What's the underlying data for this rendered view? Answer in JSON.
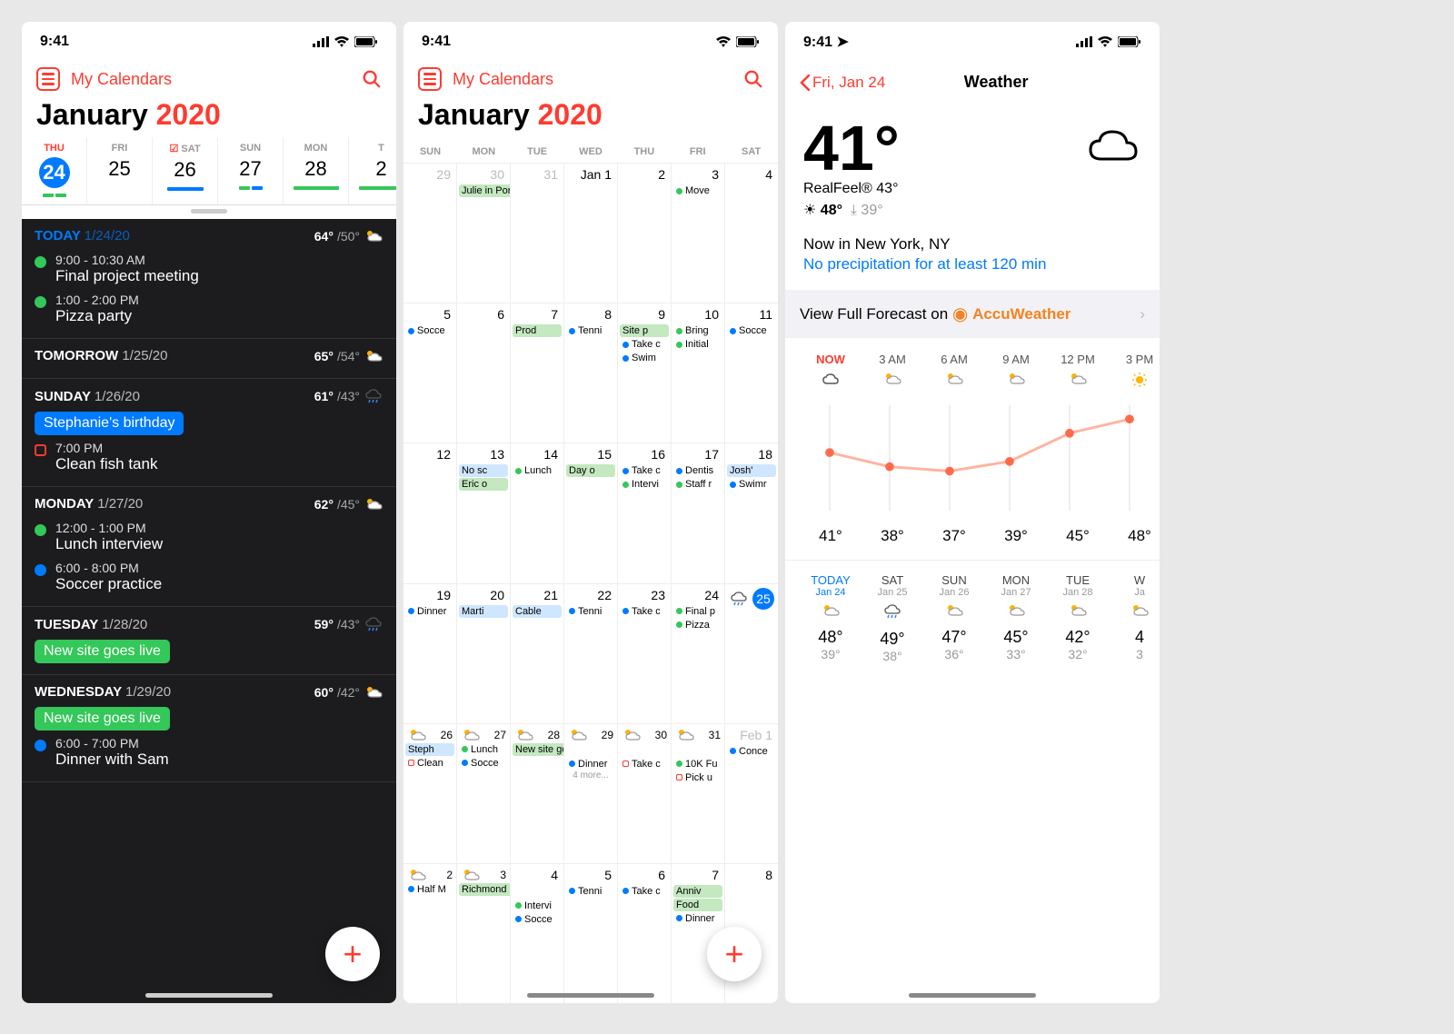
{
  "status": {
    "time": "9:41"
  },
  "header": {
    "title": "My Calendars"
  },
  "month": {
    "name": "January",
    "year": "2020"
  },
  "week": [
    {
      "dow": "THU",
      "num": "24",
      "today": true
    },
    {
      "dow": "FRI",
      "num": "25"
    },
    {
      "dow": "SAT",
      "num": "26",
      "check": true
    },
    {
      "dow": "SUN",
      "num": "27"
    },
    {
      "dow": "MON",
      "num": "28"
    },
    {
      "dow": "T",
      "num": "2"
    }
  ],
  "agenda": [
    {
      "label": "TODAY",
      "date": "1/24/20",
      "hi": "64°",
      "lo": "/50°",
      "today": true,
      "events": [
        {
          "type": "dot",
          "color": "#34c759",
          "time": "9:00 - 10:30 AM",
          "title": "Final project meeting"
        },
        {
          "type": "dot",
          "color": "#34c759",
          "time": "1:00 - 2:00 PM",
          "title": "Pizza party"
        }
      ]
    },
    {
      "label": "TOMORROW",
      "date": "1/25/20",
      "hi": "65°",
      "lo": "/54°",
      "events": []
    },
    {
      "label": "SUNDAY",
      "date": "1/26/20",
      "hi": "61°",
      "lo": "/43°",
      "events": [
        {
          "type": "chip",
          "color": "#007aff",
          "title": "Stephanie's birthday"
        },
        {
          "type": "square",
          "time": "7:00 PM",
          "title": "Clean fish tank"
        }
      ]
    },
    {
      "label": "MONDAY",
      "date": "1/27/20",
      "hi": "62°",
      "lo": "/45°",
      "events": [
        {
          "type": "dot",
          "color": "#34c759",
          "time": "12:00 - 1:00 PM",
          "title": "Lunch interview"
        },
        {
          "type": "dot",
          "color": "#007aff",
          "time": "6:00 - 8:00 PM",
          "title": "Soccer practice"
        }
      ]
    },
    {
      "label": "TUESDAY",
      "date": "1/28/20",
      "hi": "59°",
      "lo": "/43°",
      "events": [
        {
          "type": "chip",
          "color": "#34c759",
          "title": "New site goes live"
        }
      ]
    },
    {
      "label": "WEDNESDAY",
      "date": "1/29/20",
      "hi": "60°",
      "lo": "/42°",
      "events": [
        {
          "type": "chip",
          "color": "#34c759",
          "title": "New site goes live"
        },
        {
          "type": "dot",
          "color": "#007aff",
          "time": "6:00 - 7:00 PM",
          "title": "Dinner with Sam"
        }
      ]
    }
  ],
  "dows": [
    "SUN",
    "MON",
    "TUE",
    "WED",
    "THU",
    "FRI",
    "SAT"
  ],
  "grid": [
    [
      {
        "n": "29",
        "m": 1
      },
      {
        "n": "30",
        "m": 1,
        "ev": [
          {
            "block": "g",
            "t": "Julie in Portland",
            "span": 3
          }
        ]
      },
      {
        "n": "31",
        "m": 1
      },
      {
        "n": "Jan 1"
      },
      {
        "n": "2"
      },
      {
        "n": "3",
        "ev": [
          {
            "d": "#34c759",
            "t": "Move "
          }
        ]
      },
      {
        "n": "4"
      }
    ],
    [
      {
        "n": "5",
        "ev": [
          {
            "d": "#007aff",
            "t": "Socce"
          }
        ]
      },
      {
        "n": "6"
      },
      {
        "n": "7",
        "ev": [
          {
            "block": "g",
            "t": "Prod"
          }
        ]
      },
      {
        "n": "8",
        "ev": [
          {
            "d": "#007aff",
            "t": "Tenni"
          }
        ]
      },
      {
        "n": "9",
        "ev": [
          {
            "block": "g",
            "t": "Site p"
          },
          {
            "d": "#007aff",
            "t": "Take c"
          },
          {
            "d": "#007aff",
            "t": "Swim"
          }
        ]
      },
      {
        "n": "10",
        "ev": [
          {
            "d": "#34c759",
            "t": "Bring "
          },
          {
            "d": "#34c759",
            "t": "Initial "
          }
        ]
      },
      {
        "n": "11",
        "ev": [
          {
            "d": "#007aff",
            "t": "Socce"
          }
        ]
      }
    ],
    [
      {
        "n": "12"
      },
      {
        "n": "13",
        "ev": [
          {
            "block": "b",
            "t": "No sc"
          },
          {
            "block": "g",
            "t": "Eric o"
          }
        ]
      },
      {
        "n": "14",
        "ev": [
          {
            "d": "#34c759",
            "t": "Lunch"
          }
        ]
      },
      {
        "n": "15",
        "ev": [
          {
            "block": "g",
            "t": "Day o"
          }
        ]
      },
      {
        "n": "16",
        "ev": [
          {
            "d": "#007aff",
            "t": "Take c"
          },
          {
            "d": "#34c759",
            "t": "Intervi"
          }
        ]
      },
      {
        "n": "17",
        "ev": [
          {
            "d": "#007aff",
            "t": "Dentis"
          },
          {
            "d": "#34c759",
            "t": "Staff r"
          }
        ]
      },
      {
        "n": "18",
        "ev": [
          {
            "block": "b",
            "t": "Josh'"
          },
          {
            "d": "#007aff",
            "t": "Swimr"
          }
        ]
      }
    ],
    [
      {
        "n": "19",
        "ev": [
          {
            "d": "#007aff",
            "t": "Dinner"
          }
        ]
      },
      {
        "n": "20",
        "ev": [
          {
            "block": "b",
            "t": "Marti"
          }
        ]
      },
      {
        "n": "21",
        "ev": [
          {
            "block": "b",
            "t": "Cable"
          }
        ]
      },
      {
        "n": "22",
        "ev": [
          {
            "d": "#007aff",
            "t": "Tenni"
          }
        ]
      },
      {
        "n": "23",
        "ev": [
          {
            "d": "#007aff",
            "t": "Take c"
          }
        ]
      },
      {
        "n": "24",
        "ev": [
          {
            "d": "#34c759",
            "t": "Final p"
          },
          {
            "d": "#34c759",
            "t": "Pizza"
          }
        ]
      },
      {
        "n": "25",
        "today": 1,
        "wx": 1
      }
    ],
    [
      {
        "n": "26",
        "wx": 1,
        "ev": [
          {
            "block": "b",
            "t": "Steph"
          },
          {
            "sq": 1,
            "t": "Clean"
          }
        ]
      },
      {
        "n": "27",
        "wx": 1,
        "ev": [
          {
            "d": "#34c759",
            "t": "Lunch"
          },
          {
            "d": "#007aff",
            "t": "Socce"
          }
        ]
      },
      {
        "n": "28",
        "wx": 1,
        "ev": [
          {
            "block": "g",
            "t": "New site goes live",
            "span": 4
          }
        ]
      },
      {
        "n": "29",
        "wx": 1,
        "ev": [
          {
            "sp": 1
          },
          {
            "d": "#007aff",
            "t": "Dinner"
          },
          {
            "more": "4 more..."
          }
        ]
      },
      {
        "n": "30",
        "wx": 1,
        "ev": [
          {
            "sp": 1
          },
          {
            "sq": 1,
            "t": "Take c"
          }
        ]
      },
      {
        "n": "31",
        "wx": 1,
        "ev": [
          {
            "sp": 1
          },
          {
            "d": "#34c759",
            "t": "10K Fu"
          },
          {
            "sq": 1,
            "t": "Pick u"
          }
        ]
      },
      {
        "n": "Feb 1",
        "m": 1,
        "ev": [
          {
            "d": "#007aff",
            "t": "Conce"
          }
        ]
      }
    ],
    [
      {
        "n": "2",
        "wx": 1,
        "ev": [
          {
            "d": "#007aff",
            "t": "Half M"
          }
        ]
      },
      {
        "n": "3",
        "wx": 1,
        "ev": [
          {
            "block": "g",
            "t": "Richmond",
            "span": 2
          }
        ]
      },
      {
        "n": "4",
        "ev": [
          {
            "sp": 1
          },
          {
            "d": "#34c759",
            "t": "Intervi"
          },
          {
            "d": "#007aff",
            "t": "Socce"
          }
        ]
      },
      {
        "n": "5",
        "ev": [
          {
            "d": "#007aff",
            "t": "Tenni"
          }
        ]
      },
      {
        "n": "6",
        "ev": [
          {
            "d": "#007aff",
            "t": "Take c"
          }
        ]
      },
      {
        "n": "7",
        "ev": [
          {
            "block": "g",
            "t": "Anniv"
          },
          {
            "block": "g",
            "t": "Food"
          },
          {
            "d": "#007aff",
            "t": "Dinner"
          }
        ]
      },
      {
        "n": "8"
      }
    ]
  ],
  "weather": {
    "back": "Fri, Jan 24",
    "title": "Weather",
    "temp": "41°",
    "feel": "RealFeel® 43°",
    "hi": "48°",
    "lo": "39°",
    "loc": "Now in New York, NY",
    "precip": "No precipitation for at least 120 min",
    "forecast_link": "View Full Forecast on ",
    "accu": "AccuWeather",
    "hourly": [
      {
        "time": "NOW",
        "temp": "41°",
        "y": 64
      },
      {
        "time": "3 AM",
        "temp": "38°",
        "y": 80
      },
      {
        "time": "6 AM",
        "temp": "37°",
        "y": 85
      },
      {
        "time": "9 AM",
        "temp": "39°",
        "y": 74
      },
      {
        "time": "12 PM",
        "temp": "45°",
        "y": 42
      },
      {
        "time": "3 PM",
        "temp": "48°",
        "y": 26
      }
    ],
    "daily": [
      {
        "name": "TODAY",
        "date": "Jan 24",
        "hi": "48°",
        "lo": "39°",
        "today": true
      },
      {
        "name": "SAT",
        "date": "Jan 25",
        "hi": "49°",
        "lo": "38°"
      },
      {
        "name": "SUN",
        "date": "Jan 26",
        "hi": "47°",
        "lo": "36°"
      },
      {
        "name": "MON",
        "date": "Jan 27",
        "hi": "45°",
        "lo": "33°"
      },
      {
        "name": "TUE",
        "date": "Jan 28",
        "hi": "42°",
        "lo": "32°"
      },
      {
        "name": "W",
        "date": "Ja",
        "hi": "4",
        "lo": "3"
      }
    ]
  }
}
